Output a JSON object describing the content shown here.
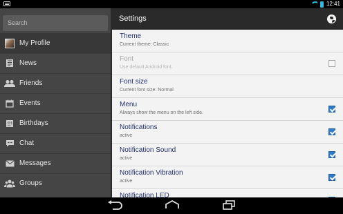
{
  "status_bar": {
    "time": "12:41"
  },
  "sidebar": {
    "search_placeholder": "Search",
    "items": [
      {
        "label": "My Profile",
        "icon": "avatar"
      },
      {
        "label": "News",
        "icon": "news-icon"
      },
      {
        "label": "Friends",
        "icon": "friends-icon"
      },
      {
        "label": "Events",
        "icon": "calendar-icon"
      },
      {
        "label": "Birthdays",
        "icon": "birthday-calendar-icon"
      },
      {
        "label": "Chat",
        "icon": "chat-icon"
      },
      {
        "label": "Messages",
        "icon": "envelope-icon"
      },
      {
        "label": "Groups",
        "icon": "groups-icon"
      }
    ]
  },
  "header": {
    "title": "Settings",
    "action_icon": "globe-icon"
  },
  "settings": [
    {
      "title": "Theme",
      "summary": "Current theme: Classic",
      "control": "none",
      "enabled": true
    },
    {
      "title": "Font",
      "summary": "Use default Android font.",
      "control": "checkbox",
      "checked": false,
      "enabled": false
    },
    {
      "title": "Font size",
      "summary": "Current font size: Normal",
      "control": "none",
      "enabled": true
    },
    {
      "title": "Menu",
      "summary": "Always show the menu on the left side.",
      "control": "checkbox",
      "checked": true,
      "enabled": true
    },
    {
      "title": "Notifications",
      "summary": "active",
      "control": "checkbox",
      "checked": true,
      "enabled": true
    },
    {
      "title": "Notification Sound",
      "summary": "active",
      "control": "checkbox",
      "checked": true,
      "enabled": true
    },
    {
      "title": "Notification Vibration",
      "summary": "active",
      "control": "checkbox",
      "checked": true,
      "enabled": true
    },
    {
      "title": "Notification LED",
      "summary": "",
      "control": "checkbox",
      "checked": true,
      "enabled": true
    }
  ],
  "colors": {
    "accent": "#33b5e5",
    "checkbox_checked": "#2f79c7",
    "sidebar_bg": "#454545",
    "actionbar_bg": "#2a2a2a",
    "pref_title": "#22306a"
  }
}
